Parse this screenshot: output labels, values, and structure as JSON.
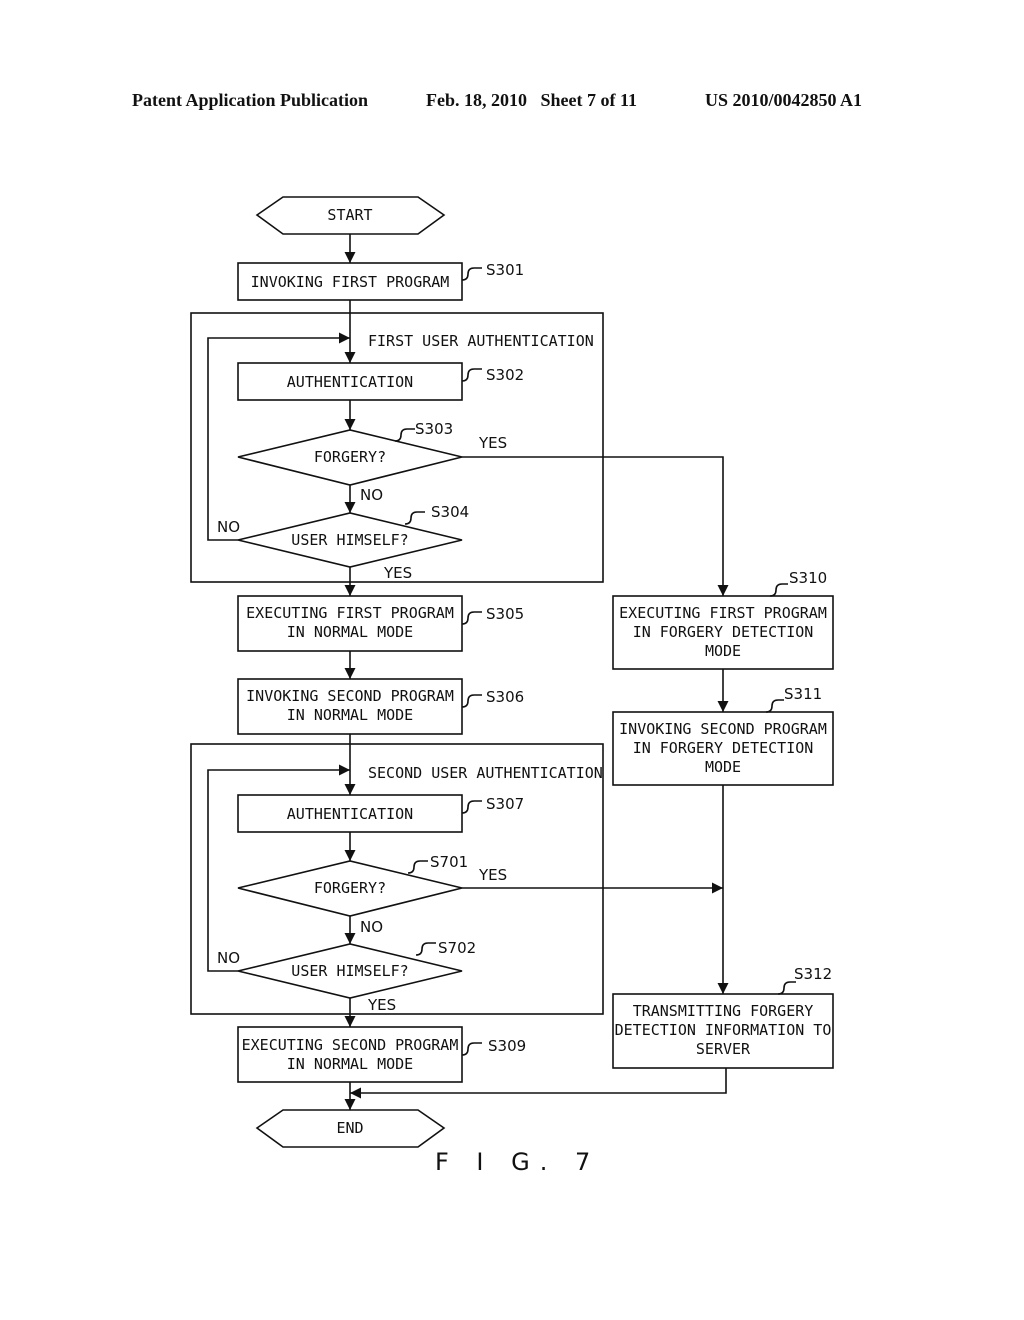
{
  "header": {
    "publication": "Patent Application Publication",
    "date_sheet": "Feb. 18, 2010   Sheet 7 of 11",
    "patent_number": "US 2010/0042850 A1"
  },
  "figure_label": "F I G. 7",
  "groups": {
    "first": "FIRST USER AUTHENTICATION",
    "second": "SECOND USER AUTHENTICATION"
  },
  "terminals": {
    "start": "START",
    "end": "END"
  },
  "steps": {
    "s301": {
      "id": "S301",
      "lines": [
        "INVOKING FIRST PROGRAM"
      ]
    },
    "s302": {
      "id": "S302",
      "lines": [
        "AUTHENTICATION"
      ]
    },
    "s303": {
      "id": "S303",
      "lines": [
        "FORGERY?"
      ]
    },
    "s304": {
      "id": "S304",
      "lines": [
        "USER HIMSELF?"
      ]
    },
    "s305": {
      "id": "S305",
      "lines": [
        "EXECUTING FIRST PROGRAM",
        "IN NORMAL MODE"
      ]
    },
    "s306": {
      "id": "S306",
      "lines": [
        "INVOKING SECOND PROGRAM",
        "IN NORMAL MODE"
      ]
    },
    "s307": {
      "id": "S307",
      "lines": [
        "AUTHENTICATION"
      ]
    },
    "s701": {
      "id": "S701",
      "lines": [
        "FORGERY?"
      ]
    },
    "s702": {
      "id": "S702",
      "lines": [
        "USER HIMSELF?"
      ]
    },
    "s309": {
      "id": "S309",
      "lines": [
        "EXECUTING SECOND PROGRAM",
        "IN NORMAL MODE"
      ]
    },
    "s310": {
      "id": "S310",
      "lines": [
        "EXECUTING FIRST PROGRAM",
        "IN FORGERY DETECTION",
        "MODE"
      ]
    },
    "s311": {
      "id": "S311",
      "lines": [
        "INVOKING SECOND PROGRAM",
        "IN FORGERY DETECTION",
        "MODE"
      ]
    },
    "s312": {
      "id": "S312",
      "lines": [
        "TRANSMITTING FORGERY",
        "DETECTION INFORMATION TO",
        "SERVER"
      ]
    }
  },
  "branch_labels": {
    "yes": "YES",
    "no": "NO"
  }
}
